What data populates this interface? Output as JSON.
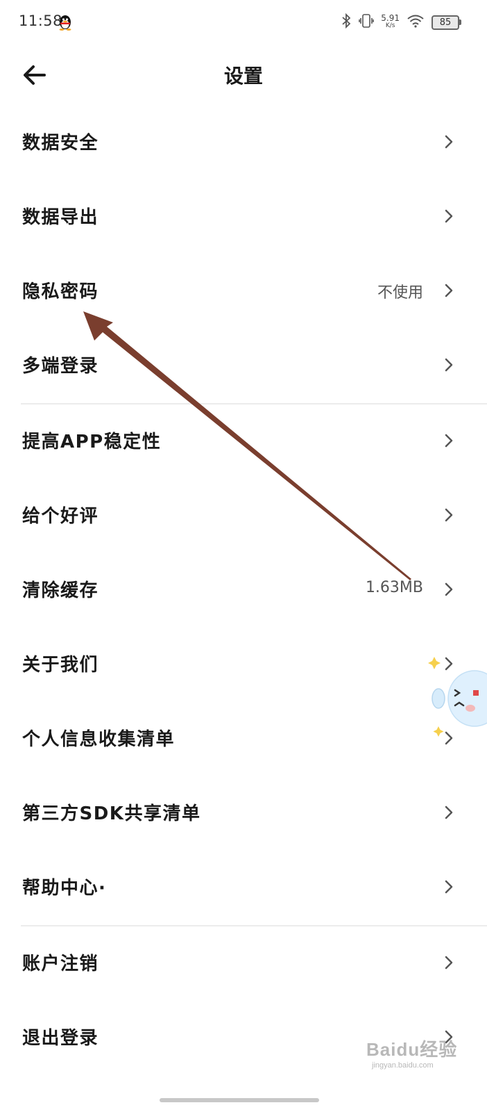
{
  "status_bar": {
    "time": "11:58",
    "network_speed": "5.91",
    "network_unit": "K/s",
    "battery": "85",
    "icons": [
      "qq-penguin-icon",
      "bluetooth-icon",
      "vibrate-icon",
      "wifi-icon",
      "battery-icon"
    ]
  },
  "header": {
    "title": "设置",
    "back_icon": "arrow-left-icon"
  },
  "settings": {
    "items": [
      {
        "label": "数据安全",
        "value": ""
      },
      {
        "label": "数据导出",
        "value": ""
      },
      {
        "label": "隐私密码",
        "value": "不使用"
      },
      {
        "label": "多端登录",
        "value": ""
      },
      {
        "label": "提高APP稳定性",
        "value": ""
      },
      {
        "label": "给个好评",
        "value": ""
      },
      {
        "label": "清除缓存",
        "value": "1.63MB"
      },
      {
        "label": "关于我们",
        "value": ""
      },
      {
        "label": "个人信息收集清单",
        "value": ""
      },
      {
        "label": "第三方SDK共享清单",
        "value": ""
      },
      {
        "label": "帮助中心·",
        "value": ""
      },
      {
        "label": "账户注销",
        "value": ""
      },
      {
        "label": "退出登录",
        "value": ""
      }
    ]
  },
  "annotation": {
    "color": "#7a3e2e",
    "target": "隐私密码"
  },
  "watermark": {
    "main": "Baidu经验",
    "sub": "jingyan.baidu.com"
  }
}
